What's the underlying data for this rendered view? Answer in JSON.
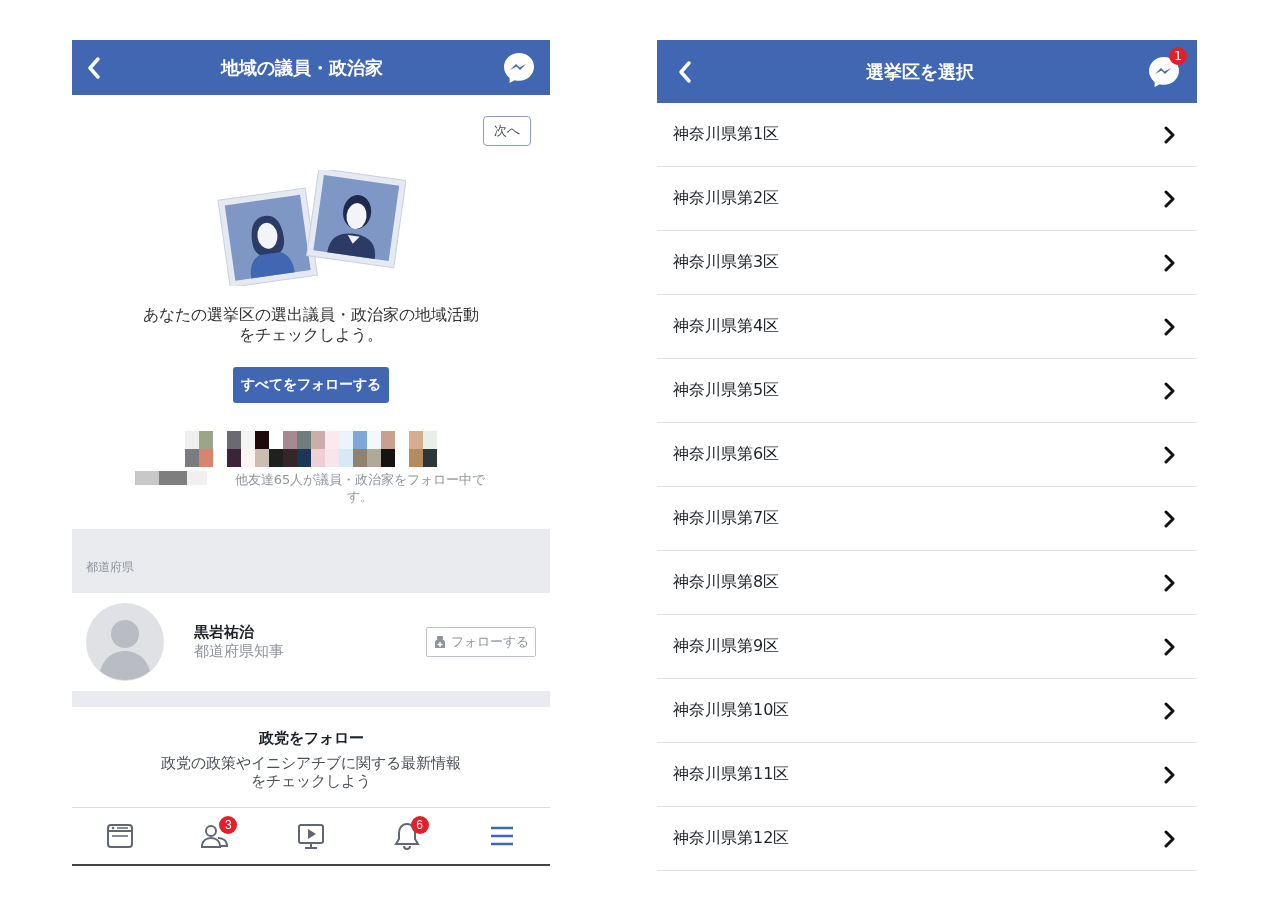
{
  "left_screen": {
    "header": {
      "title": "地域の議員・政治家"
    },
    "next_button": "次へ",
    "intro": "あなたの選挙区の選出議員・政治家の地域活動をチェックしよう。",
    "follow_all_button": "すべてをフォローする",
    "friends_note": "他友達65人が議員・政治家をフォロー中です。",
    "section_label": "都道府県",
    "politicians": [
      {
        "name": "黒岩祐治",
        "role": "都道府県知事",
        "follow_button": "フォローする"
      }
    ],
    "party_section": {
      "title": "政党をフォロー",
      "description": "政党の政策やイニシアチブに関する最新情報をチェックしよう"
    },
    "tab_bar": [
      {
        "kind": "news",
        "selected": false
      },
      {
        "kind": "friends",
        "selected": false,
        "badge": "3"
      },
      {
        "kind": "video",
        "selected": false
      },
      {
        "kind": "notifications",
        "selected": false,
        "badge": "6"
      },
      {
        "kind": "menu",
        "selected": true
      }
    ]
  },
  "right_screen": {
    "header": {
      "title": "選挙区を選択",
      "badge": "1"
    },
    "districts": [
      "神奈川県第1区",
      "神奈川県第2区",
      "神奈川県第3区",
      "神奈川県第4区",
      "神奈川県第5区",
      "神奈川県第6区",
      "神奈川県第7区",
      "神奈川県第8区",
      "神奈川県第9区",
      "神奈川県第10区",
      "神奈川県第11区",
      "神奈川県第12区"
    ]
  }
}
